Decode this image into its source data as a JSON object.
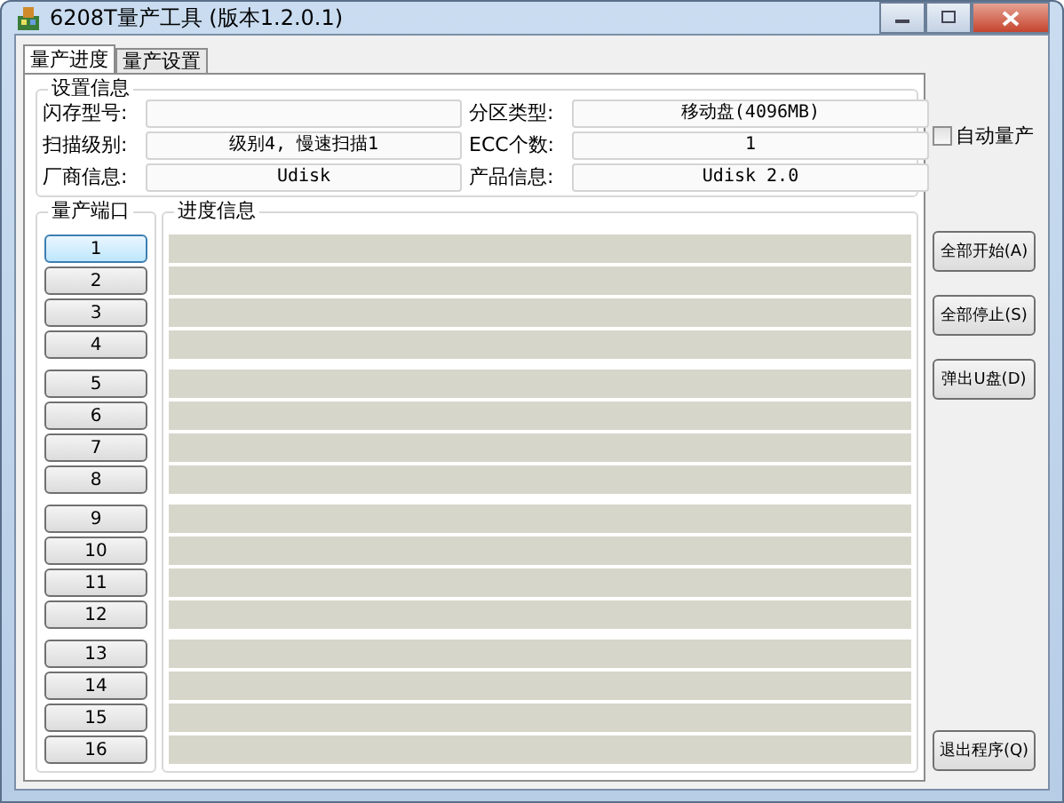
{
  "window": {
    "title": "6208T量产工具 (版本1.2.0.1)"
  },
  "tabs": [
    {
      "label": "量产进度",
      "selected": true
    },
    {
      "label": "量产设置",
      "selected": false
    }
  ],
  "settings": {
    "title": "设置信息",
    "fields": [
      {
        "label": "闪存型号:"
      },
      {
        "label": "分区类型:",
        "value": "移动盘(4096MB)"
      },
      {
        "label": "扫描级别:",
        "value": "级别4, 慢速扫描1"
      },
      {
        "label": "ECC个数:",
        "value": "1"
      },
      {
        "label": "厂商信息:",
        "value": "Udisk"
      },
      {
        "label": "产品信息:",
        "value": "Udisk 2.0"
      }
    ]
  },
  "auto_production": {
    "label": "自动量产",
    "checked": false
  },
  "ports": {
    "title": "量产端口",
    "items": [
      {
        "label": "1",
        "selected": true
      },
      {
        "label": "2",
        "selected": false
      },
      {
        "label": "3",
        "selected": false
      },
      {
        "label": "4",
        "selected": false
      },
      {
        "label": "5",
        "selected": false
      },
      {
        "label": "6",
        "selected": false
      },
      {
        "label": "7",
        "selected": false
      },
      {
        "label": "8",
        "selected": false
      },
      {
        "label": "9",
        "selected": false
      },
      {
        "label": "10",
        "selected": false
      },
      {
        "label": "11",
        "selected": false
      },
      {
        "label": "12",
        "selected": false
      },
      {
        "label": "13",
        "selected": false
      },
      {
        "label": "14",
        "selected": false
      },
      {
        "label": "15",
        "selected": false
      },
      {
        "label": "16",
        "selected": false
      }
    ]
  },
  "progress": {
    "title": "进度信息"
  },
  "buttons": [
    "全部开始(A)",
    "全部停止(S)",
    "弹出U盘(D)"
  ],
  "exit_button": "退出程序(Q)"
}
